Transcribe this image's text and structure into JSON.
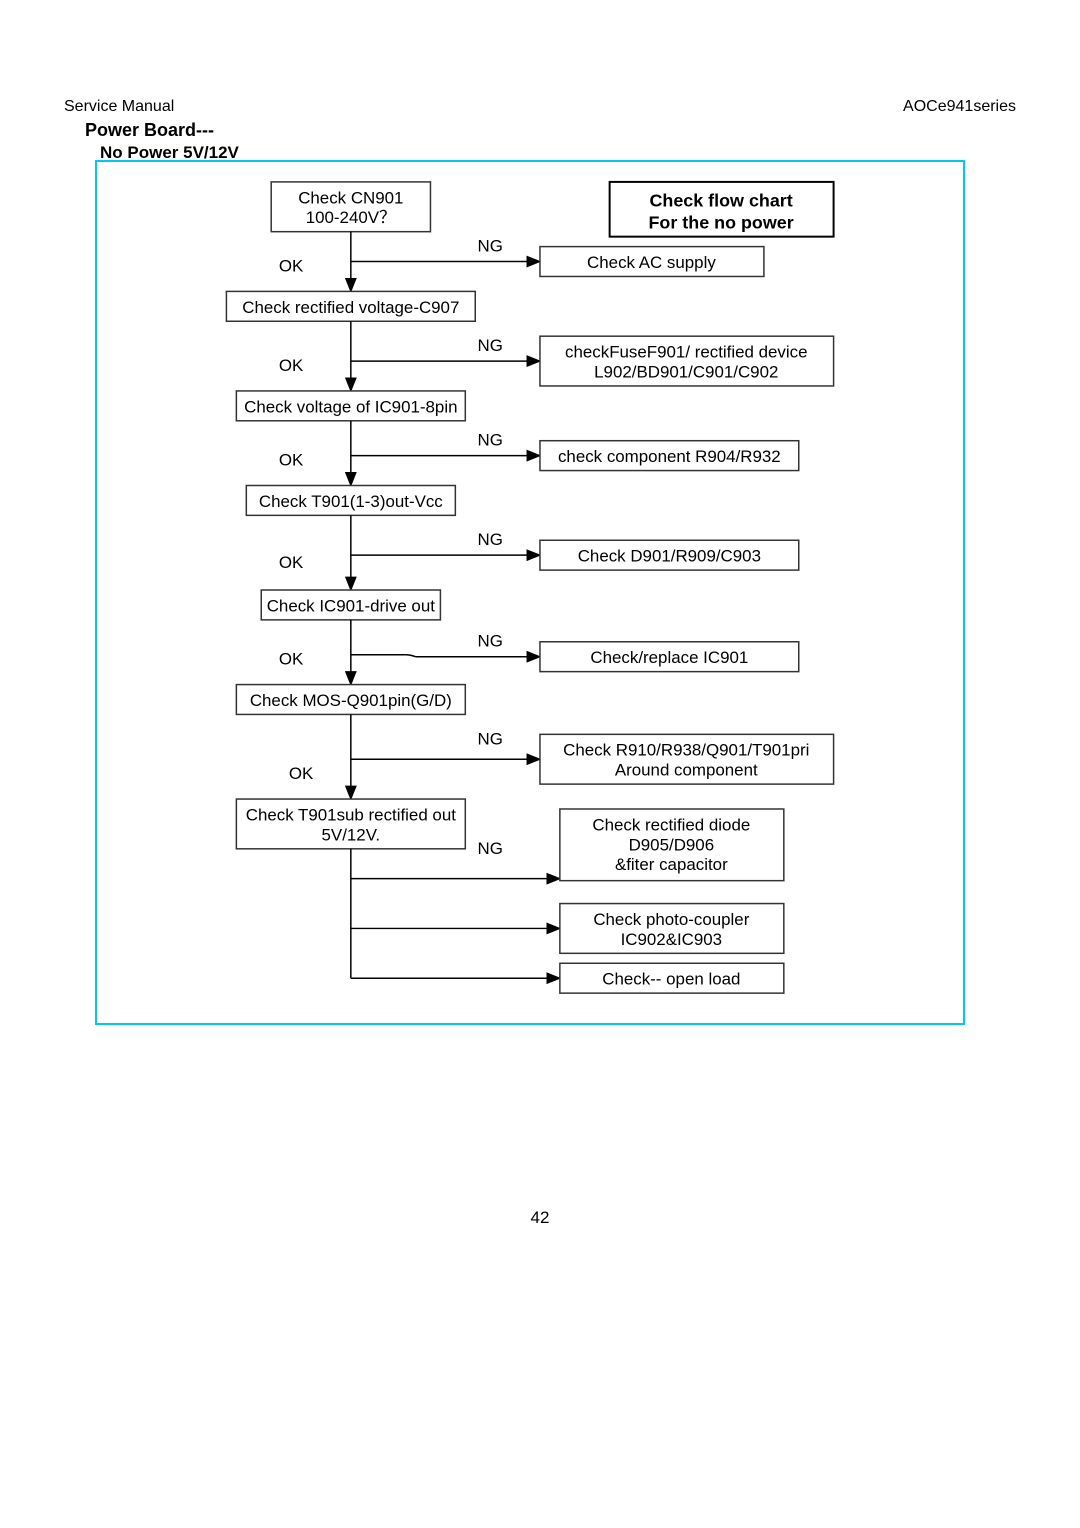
{
  "header": {
    "left": "Service Manual",
    "right": "AOCe941series"
  },
  "title": {
    "main": "Power Board---",
    "sub": "No Power 5V/12V"
  },
  "chart_data": {
    "type": "flowchart",
    "title_box": {
      "line1": "Check flow chart",
      "line2": "For the no power"
    },
    "steps": [
      {
        "check": {
          "line1": "Check CN901",
          "line2": "100-240V？"
        },
        "ok_label": "OK",
        "ng_label": "NG",
        "ng_action": {
          "line1": "Check AC supply"
        }
      },
      {
        "check": {
          "line1": "Check rectified voltage-C907"
        },
        "ok_label": "OK",
        "ng_label": "NG",
        "ng_action": {
          "line1": "checkFuseF901/ rectified device",
          "line2": "L902/BD901/C901/C902"
        }
      },
      {
        "check": {
          "line1": "Check voltage of IC901-8pin"
        },
        "ok_label": "OK",
        "ng_label": "NG",
        "ng_action": {
          "line1": "check component R904/R932"
        }
      },
      {
        "check": {
          "line1": "Check T901(1-3)out-Vcc"
        },
        "ok_label": "OK",
        "ng_label": "NG",
        "ng_action": {
          "line1": "Check D901/R909/C903"
        }
      },
      {
        "check": {
          "line1": "Check IC901-drive out"
        },
        "ok_label": "OK",
        "ng_label": "NG",
        "ng_action": {
          "line1": "Check/replace IC901"
        }
      },
      {
        "check": {
          "line1": "Check MOS-Q901pin(G/D)"
        },
        "ok_label": "OK",
        "ng_label": "NG",
        "ng_action": {
          "line1": "Check R910/R938/Q901/T901pri",
          "line2": "Around component"
        }
      },
      {
        "check": {
          "line1": "Check T901sub rectified out",
          "line2": "5V/12V."
        },
        "ng_label": "NG",
        "ng_actions": [
          {
            "line1": "Check rectified diode",
            "line2": "D905/D906",
            "line3": "&fiter capacitor"
          },
          {
            "line1": "Check photo-coupler",
            "line2": "IC902&IC903"
          },
          {
            "line1": "Check-- open load"
          }
        ]
      }
    ]
  },
  "page_number": "42"
}
